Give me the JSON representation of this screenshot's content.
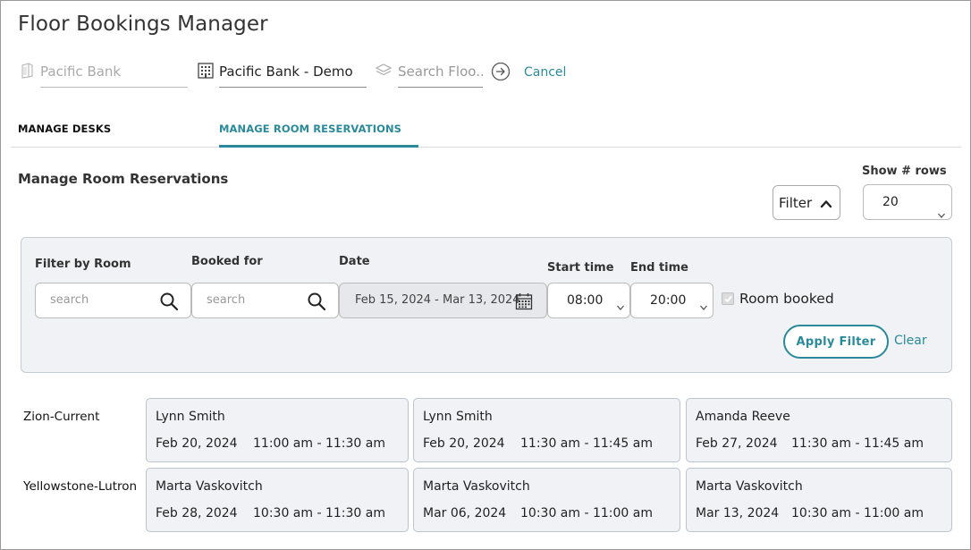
{
  "app": {
    "title": "Floor Bookings Manager"
  },
  "selectors": {
    "bank": "Pacific Bank",
    "building": "Pacific Bank - Demo",
    "floor_placeholder": "Search Floo..."
  },
  "header_actions": {
    "cancel_label": "Cancel"
  },
  "tabs": [
    {
      "label": "MANAGE DESKS",
      "active": false
    },
    {
      "label": "MANAGE ROOM RESERVATIONS",
      "active": true
    }
  ],
  "section": {
    "title": "Manage Room Reservations",
    "filter_label": "Filter",
    "rows_label": "Show # rows",
    "rows_value": "20"
  },
  "filter_panel": {
    "room_label": "Filter by Room",
    "room_placeholder": "search",
    "booked_label": "Booked for",
    "booked_placeholder": "search",
    "date_label": "Date",
    "date_value": "Feb 15, 2024 - Mar 13, 2024",
    "start_label": "Start time",
    "start_value": "08:00",
    "end_label": "End time",
    "end_value": "20:00",
    "room_booked_label": "Room booked",
    "room_booked_checked": true,
    "apply_label": "Apply Filter",
    "clear_label": "Clear"
  },
  "colors": {
    "accent": "#2a8a99",
    "panel_bg": "#f0f2f6"
  },
  "rooms": [
    {
      "name": "Zion-Current",
      "bookings": [
        {
          "person": "Lynn Smith",
          "date": "Feb 20, 2024",
          "time": "11:00 am - 11:30 am"
        },
        {
          "person": "Lynn Smith",
          "date": "Feb 20, 2024",
          "time": "11:30 am - 11:45 am"
        },
        {
          "person": "Amanda Reeve",
          "date": "Feb 27, 2024",
          "time": "11:30 am - 11:45 am"
        }
      ]
    },
    {
      "name": "Yellowstone-Lutron",
      "bookings": [
        {
          "person": "Marta Vaskovitch",
          "date": "Feb 28, 2024",
          "time": "10:30 am - 11:30 am"
        },
        {
          "person": "Marta Vaskovitch",
          "date": "Mar 06, 2024",
          "time": "10:30 am - 11:00 am"
        },
        {
          "person": "Marta Vaskovitch",
          "date": "Mar 13, 2024",
          "time": "10:30 am - 11:00 am"
        }
      ]
    }
  ]
}
